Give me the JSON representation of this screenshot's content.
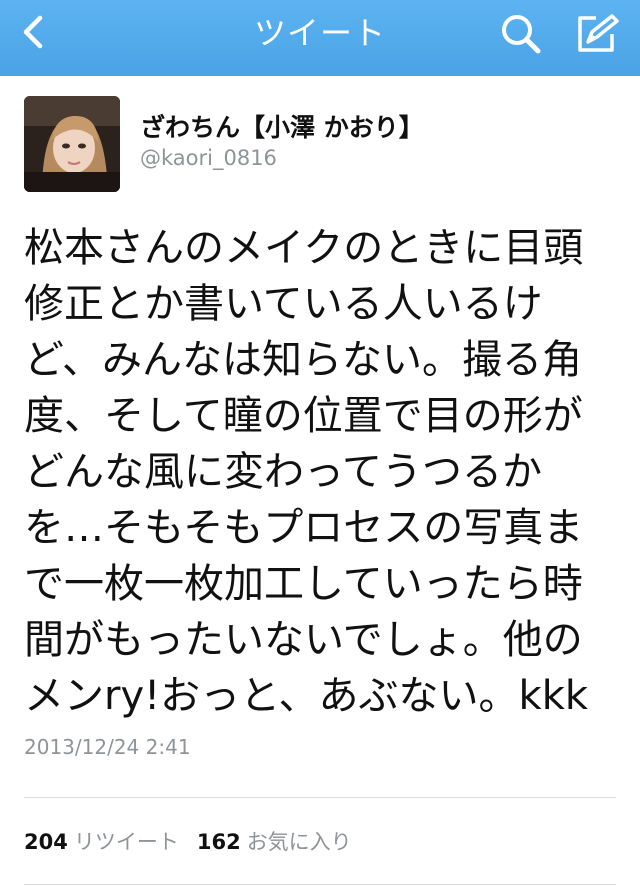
{
  "nav": {
    "title": "ツイート",
    "back_icon": "chevron-left-icon",
    "search_icon": "search-icon",
    "compose_icon": "compose-icon",
    "bar_color": "#55acee"
  },
  "tweet": {
    "user": {
      "name": "ざわちん【小澤 かおり】",
      "handle": "@kaori_0816"
    },
    "lines": [
      "松本さんのメイクのときに目頭",
      "修正とか書いている人いるけ",
      "ど、みんなは知らない。撮る角",
      "度、そして瞳の位置で目の形が",
      "どんな風に変わってうつるか",
      "を…そもそもプロセスの写真ま",
      "で一枚一枚加工していったら時",
      "間がもったいないでしょ。他の",
      "メンry!おっと、あぶない。kkk"
    ],
    "timestamp": "2013/12/24 2:41",
    "retweet_count": "204",
    "retweet_label": "リツイート",
    "favorite_count": "162",
    "favorite_label": "お気に入り"
  }
}
